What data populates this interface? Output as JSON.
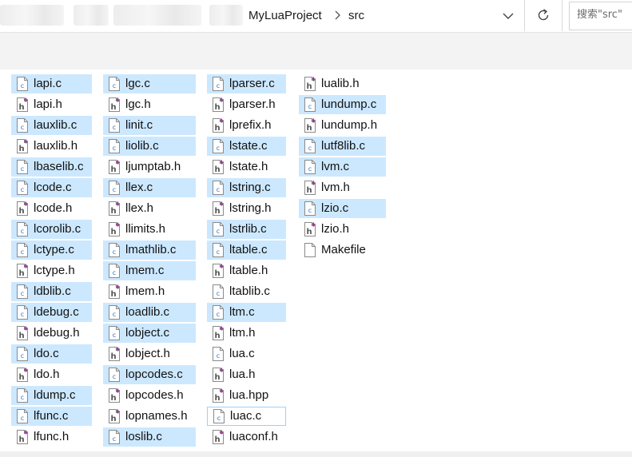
{
  "address": {
    "path": [
      {
        "label": "MyLuaProject"
      },
      {
        "label": "src"
      }
    ],
    "search_placeholder": "搜索\"src\""
  },
  "columns": [
    [
      {
        "name": "lapi.c",
        "type": "c",
        "selected": true
      },
      {
        "name": "lapi.h",
        "type": "h",
        "selected": false
      },
      {
        "name": "lauxlib.c",
        "type": "c",
        "selected": true
      },
      {
        "name": "lauxlib.h",
        "type": "h",
        "selected": false
      },
      {
        "name": "lbaselib.c",
        "type": "c",
        "selected": true
      },
      {
        "name": "lcode.c",
        "type": "c",
        "selected": true
      },
      {
        "name": "lcode.h",
        "type": "h",
        "selected": false
      },
      {
        "name": "lcorolib.c",
        "type": "c",
        "selected": true
      },
      {
        "name": "lctype.c",
        "type": "c",
        "selected": true
      },
      {
        "name": "lctype.h",
        "type": "h",
        "selected": false
      },
      {
        "name": "ldblib.c",
        "type": "c",
        "selected": true
      },
      {
        "name": "ldebug.c",
        "type": "c",
        "selected": true
      },
      {
        "name": "ldebug.h",
        "type": "h",
        "selected": false
      },
      {
        "name": "ldo.c",
        "type": "c",
        "selected": true
      },
      {
        "name": "ldo.h",
        "type": "h",
        "selected": false
      },
      {
        "name": "ldump.c",
        "type": "c",
        "selected": true
      },
      {
        "name": "lfunc.c",
        "type": "c",
        "selected": true
      },
      {
        "name": "lfunc.h",
        "type": "h",
        "selected": false
      }
    ],
    [
      {
        "name": "lgc.c",
        "type": "c",
        "selected": true
      },
      {
        "name": "lgc.h",
        "type": "h",
        "selected": false
      },
      {
        "name": "linit.c",
        "type": "c",
        "selected": true
      },
      {
        "name": "liolib.c",
        "type": "c",
        "selected": true
      },
      {
        "name": "ljumptab.h",
        "type": "h",
        "selected": false
      },
      {
        "name": "llex.c",
        "type": "c",
        "selected": true
      },
      {
        "name": "llex.h",
        "type": "h",
        "selected": false
      },
      {
        "name": "llimits.h",
        "type": "h",
        "selected": false
      },
      {
        "name": "lmathlib.c",
        "type": "c",
        "selected": true
      },
      {
        "name": "lmem.c",
        "type": "c",
        "selected": true
      },
      {
        "name": "lmem.h",
        "type": "h",
        "selected": false
      },
      {
        "name": "loadlib.c",
        "type": "c",
        "selected": true
      },
      {
        "name": "lobject.c",
        "type": "c",
        "selected": true
      },
      {
        "name": "lobject.h",
        "type": "h",
        "selected": false
      },
      {
        "name": "lopcodes.c",
        "type": "c",
        "selected": true
      },
      {
        "name": "lopcodes.h",
        "type": "h",
        "selected": false
      },
      {
        "name": "lopnames.h",
        "type": "h",
        "selected": false
      },
      {
        "name": "loslib.c",
        "type": "c",
        "selected": true
      }
    ],
    [
      {
        "name": "lparser.c",
        "type": "c",
        "selected": true
      },
      {
        "name": "lparser.h",
        "type": "h",
        "selected": false
      },
      {
        "name": "lprefix.h",
        "type": "h",
        "selected": false
      },
      {
        "name": "lstate.c",
        "type": "c",
        "selected": true
      },
      {
        "name": "lstate.h",
        "type": "h",
        "selected": false
      },
      {
        "name": "lstring.c",
        "type": "c",
        "selected": true
      },
      {
        "name": "lstring.h",
        "type": "h",
        "selected": false
      },
      {
        "name": "lstrlib.c",
        "type": "c",
        "selected": true
      },
      {
        "name": "ltable.c",
        "type": "c",
        "selected": true
      },
      {
        "name": "ltable.h",
        "type": "h",
        "selected": false
      },
      {
        "name": "ltablib.c",
        "type": "c",
        "selected": false
      },
      {
        "name": "ltm.c",
        "type": "c",
        "selected": true
      },
      {
        "name": "ltm.h",
        "type": "h",
        "selected": false
      },
      {
        "name": "lua.c",
        "type": "c",
        "selected": false
      },
      {
        "name": "lua.h",
        "type": "h",
        "selected": false
      },
      {
        "name": "lua.hpp",
        "type": "h",
        "selected": false
      },
      {
        "name": "luac.c",
        "type": "c",
        "selected": false,
        "focused": true
      },
      {
        "name": "luaconf.h",
        "type": "h",
        "selected": false
      }
    ],
    [
      {
        "name": "lualib.h",
        "type": "h",
        "selected": false
      },
      {
        "name": "lundump.c",
        "type": "c",
        "selected": true
      },
      {
        "name": "lundump.h",
        "type": "h",
        "selected": false
      },
      {
        "name": "lutf8lib.c",
        "type": "c",
        "selected": true
      },
      {
        "name": "lvm.c",
        "type": "c",
        "selected": true
      },
      {
        "name": "lvm.h",
        "type": "h",
        "selected": false
      },
      {
        "name": "lzio.c",
        "type": "c",
        "selected": true
      },
      {
        "name": "lzio.h",
        "type": "h",
        "selected": false
      },
      {
        "name": "Makefile",
        "type": "file",
        "selected": false
      }
    ]
  ],
  "colors": {
    "selection": "#cce8ff",
    "focus_border": "#99d1ff",
    "toolbar_bg": "#f3f3f3",
    "c_icon_accent": "#2a73c6",
    "h_icon_accent": "#8e2a8e"
  }
}
